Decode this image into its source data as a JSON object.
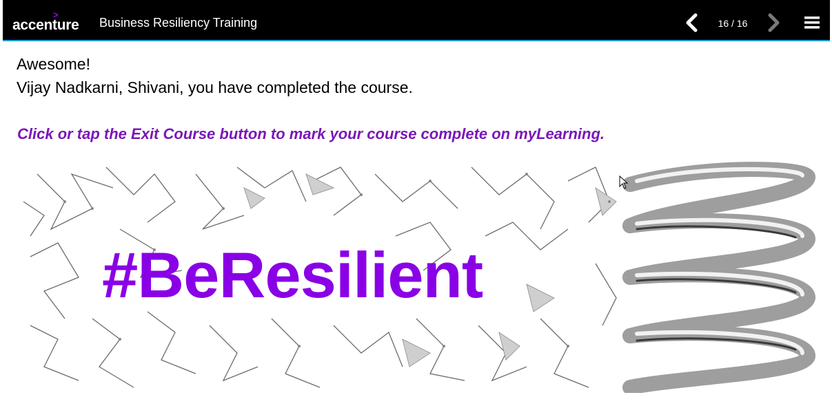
{
  "header": {
    "logo_text": "accenture",
    "logo_mark": ">",
    "course_title": "Business Resiliency Training",
    "page_counter": "16 / 16",
    "prev_icon": "chevron-left-icon",
    "next_icon": "chevron-right-icon",
    "menu_icon": "hamburger-menu-icon"
  },
  "content": {
    "line1": "Awesome!",
    "line2": "Vijay Nadkarni, Shivani, you have completed the course.",
    "instruction": "Click or tap the Exit Course button to mark your course complete on myLearning."
  },
  "banner": {
    "text": "#BeResilient"
  },
  "colors": {
    "header_bg": "#000000",
    "header_accent_line": "#1da1d7",
    "brand_purple": "#a100ff",
    "instruction_purple": "#7a17b8",
    "banner_text_purple": "#8a00e6"
  }
}
